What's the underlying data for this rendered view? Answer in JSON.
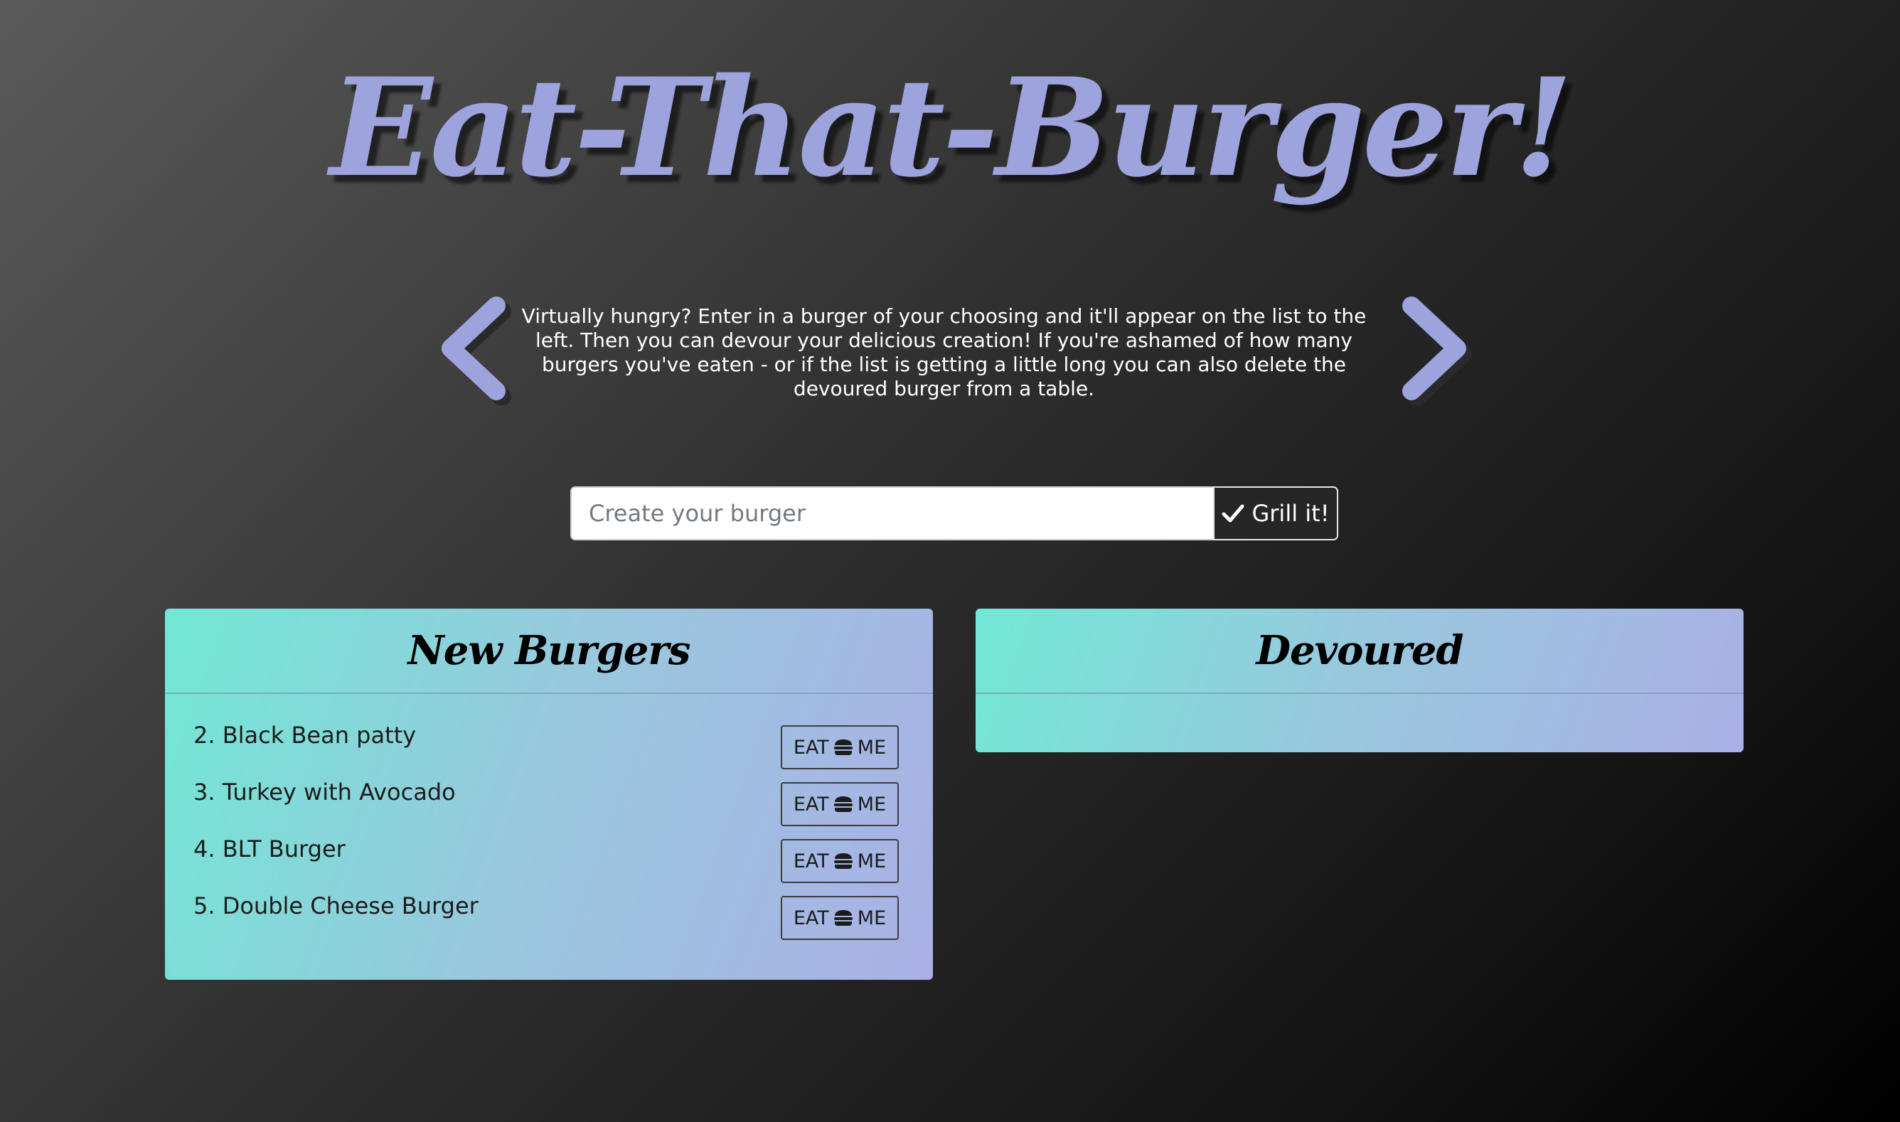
{
  "header": {
    "title": "Eat-That-Burger!",
    "description": "Virtually hungry? Enter in a burger of your choosing and it'll appear on the list to the left. Then you can devour your delicious creation! If you're ashamed of how many burgers you've eaten - or if the list is getting a little long you can also delete the devoured burger from a table."
  },
  "carousel": {
    "prev_icon": "chevron-left-icon",
    "next_icon": "chevron-right-icon"
  },
  "form": {
    "input_placeholder": "Create your burger",
    "input_value": "",
    "submit_label": "Grill it!",
    "submit_icon": "check-icon"
  },
  "new_burgers": {
    "title": "New Burgers",
    "items": [
      {
        "label": "2. Black Bean patty",
        "button_left": "EAT",
        "button_right": "ME"
      },
      {
        "label": "3. Turkey with Avocado",
        "button_left": "EAT",
        "button_right": "ME"
      },
      {
        "label": "4. BLT Burger",
        "button_left": "EAT",
        "button_right": "ME"
      },
      {
        "label": "5. Double Cheese Burger",
        "button_left": "EAT",
        "button_right": "ME"
      }
    ]
  },
  "devoured": {
    "title": "Devoured",
    "items": []
  },
  "colors": {
    "accent": "#9da3dc",
    "card_gradient_start": "#71e8d6",
    "card_gradient_end": "#aab0e6",
    "button_dark": "#262626"
  }
}
